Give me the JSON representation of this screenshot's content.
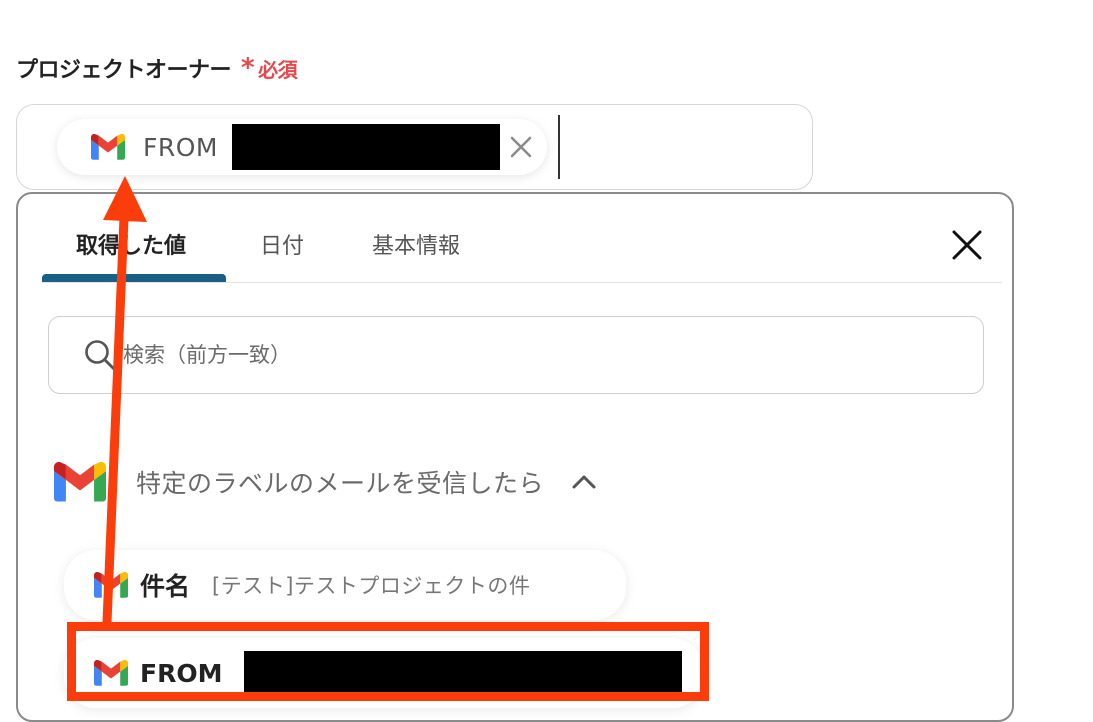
{
  "field": {
    "label": "プロジェクトオーナー",
    "required_star": "*",
    "required_text": "必須"
  },
  "owner_input": {
    "chip_icon": "gmail-icon",
    "chip_text": "FROM",
    "chip_remove_icon": "close-icon"
  },
  "panel": {
    "tabs": [
      {
        "label": "取得した値",
        "active": true
      },
      {
        "label": "日付",
        "active": false
      },
      {
        "label": "基本情報",
        "active": false
      }
    ],
    "close_icon": "close-icon",
    "search": {
      "icon": "search-icon",
      "placeholder": "検索（前方一致）"
    },
    "group": {
      "icon": "gmail-icon",
      "title": "特定のラベルのメールを受信したら",
      "chevron_icon": "chevron-up-icon"
    },
    "items": [
      {
        "label": "件名",
        "value": "[テスト]テストプロジェクトの件",
        "icon": "gmail-icon"
      },
      {
        "label": "FROM",
        "icon": "gmail-icon"
      }
    ]
  },
  "colors": {
    "accent": "#1a5f86",
    "required": "#e8474b",
    "annotation": "#fa3d0a"
  }
}
